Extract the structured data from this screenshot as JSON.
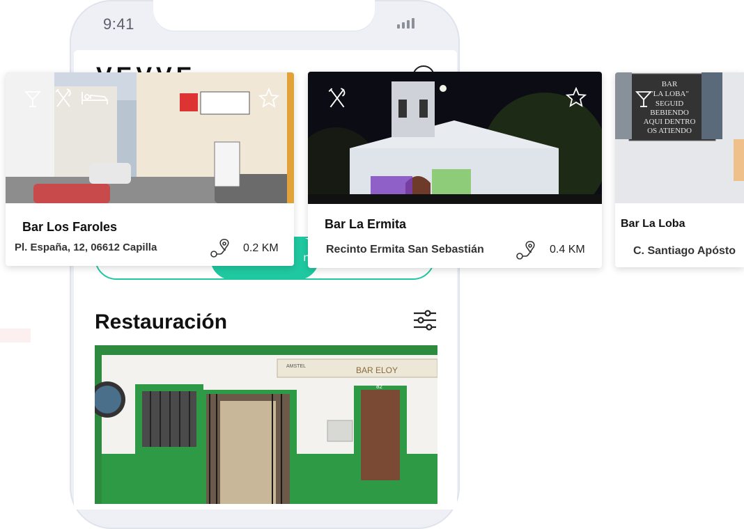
{
  "status_bar": {
    "time": "9:41"
  },
  "app": {
    "logo_text": "VEVVE"
  },
  "tabs": {
    "active_label": "n"
  },
  "section": {
    "title": "Restauración"
  },
  "featured": {
    "sign_text": "BAR ELOY",
    "sign_brand": "AMSTEL",
    "door_number": "82"
  },
  "cards": [
    {
      "name": "Bar Los Faroles",
      "address": "Pl. España, 12, 06612 Capilla",
      "distance": "0.2 KM",
      "icons": [
        "cocktail-icon",
        "cutlery-icon",
        "bed-icon",
        "star-icon"
      ]
    },
    {
      "name": "Bar La Ermita",
      "address": "Recinto Ermita San Sebastián",
      "distance": "0.4 KM",
      "icons": [
        "cutlery-icon",
        "star-icon"
      ]
    },
    {
      "name": "Bar La Loba",
      "address": "C. Santiago Apósto",
      "sign_lines": [
        "BAR",
        "\"LA LOBA\"",
        "SEGUID",
        "BEBIENDO",
        "AQUI DENTRO",
        "OS ATIENDO"
      ],
      "icons": [
        "cocktail-icon"
      ]
    }
  ],
  "colors": {
    "accent": "#1fc8a0",
    "phone_frame": "#eef0f6",
    "text": "#111111"
  }
}
